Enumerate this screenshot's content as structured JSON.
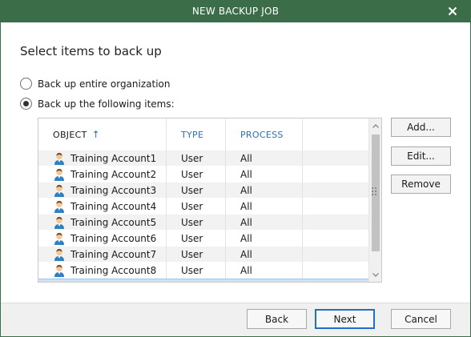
{
  "window": {
    "title": "NEW BACKUP JOB",
    "close_icon": "close-icon"
  },
  "heading": "Select items to back up",
  "options": [
    {
      "label": "Back up entire organization",
      "checked": false
    },
    {
      "label": "Back up the following items:",
      "checked": true
    }
  ],
  "grid": {
    "columns": {
      "object": "OBJECT",
      "type": "TYPE",
      "process": "PROCESS"
    },
    "sort_icon": "sort-ascending-icon",
    "rows": [
      {
        "object": "Training Account1",
        "type": "User",
        "process": "All"
      },
      {
        "object": "Training Account2",
        "type": "User",
        "process": "All"
      },
      {
        "object": "Training Account3",
        "type": "User",
        "process": "All"
      },
      {
        "object": "Training Account4",
        "type": "User",
        "process": "All"
      },
      {
        "object": "Training Account5",
        "type": "User",
        "process": "All"
      },
      {
        "object": "Training Account6",
        "type": "User",
        "process": "All"
      },
      {
        "object": "Training Account7",
        "type": "User",
        "process": "All"
      },
      {
        "object": "Training Account8",
        "type": "User",
        "process": "All"
      }
    ],
    "row_icon": "user-icon"
  },
  "side_buttons": {
    "add": "Add...",
    "edit": "Edit...",
    "remove": "Remove"
  },
  "footer": {
    "back": "Back",
    "next": "Next",
    "cancel": "Cancel"
  },
  "colors": {
    "titlebar": "#3b6e48",
    "accent": "#2b6fb6",
    "selection": "#cfe3f7"
  }
}
